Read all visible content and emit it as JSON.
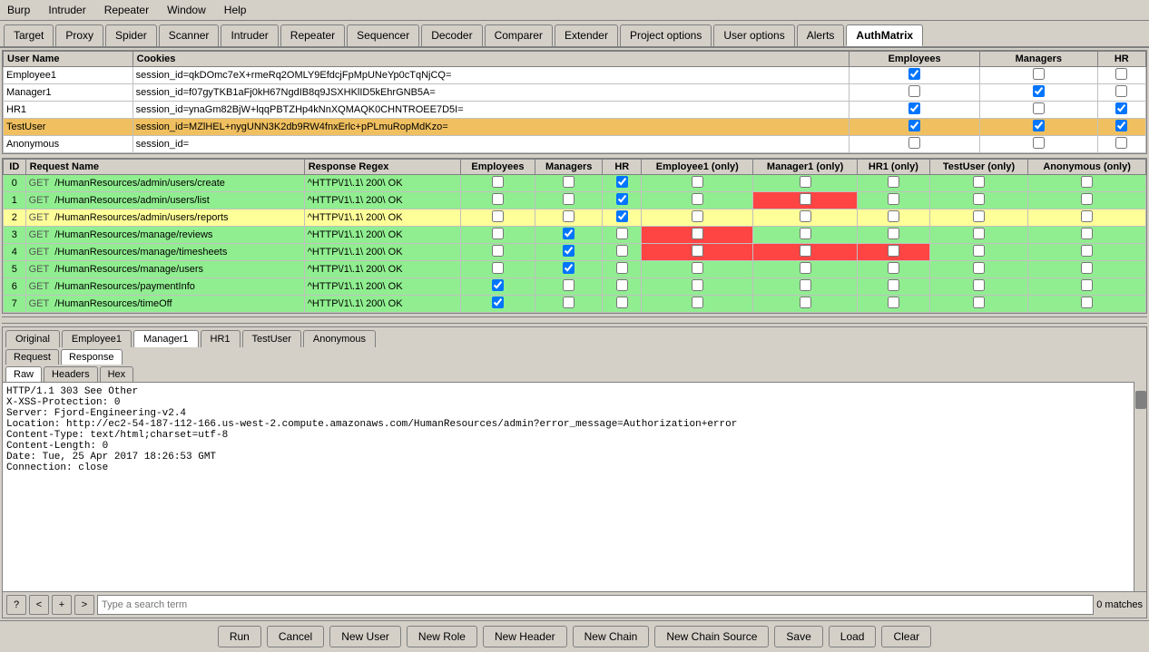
{
  "menu": {
    "items": [
      "Burp",
      "Intruder",
      "Repeater",
      "Window",
      "Help"
    ]
  },
  "tabs": {
    "items": [
      "Target",
      "Proxy",
      "Spider",
      "Scanner",
      "Intruder",
      "Repeater",
      "Sequencer",
      "Decoder",
      "Comparer",
      "Extender",
      "Project options",
      "User options",
      "Alerts",
      "AuthMatrix"
    ],
    "active": "AuthMatrix"
  },
  "user_table": {
    "headers": [
      "User Name",
      "Cookies",
      "Employees",
      "Managers",
      "HR"
    ],
    "rows": [
      {
        "name": "Employee1",
        "cookies": "session_id=qkDOmc7eX+rmeRq2OMLY9EfdcjFpMpUNeYp0cTqNjCQ=",
        "employees": true,
        "managers": false,
        "hr": false,
        "selected": false
      },
      {
        "name": "Manager1",
        "cookies": "session_id=f07gyTKB1aFj0kH67NgdIB8q9JSXHKlID5kEhrGNB5A=",
        "employees": false,
        "managers": true,
        "hr": false,
        "selected": false
      },
      {
        "name": "HR1",
        "cookies": "session_id=ynaGm82BjW+lqqPBTZHp4kNnXQMAQK0CHNTROEE7D5I=",
        "employees": true,
        "managers": false,
        "hr": true,
        "selected": false
      },
      {
        "name": "TestUser",
        "cookies": "session_id=MZlHEL+nygUNN3K2db9RW4fnxErlc+pPLmuRopMdKzo=",
        "employees": true,
        "managers": true,
        "hr": true,
        "selected": true
      },
      {
        "name": "Anonymous",
        "cookies": "session_id=",
        "employees": false,
        "managers": false,
        "hr": false,
        "selected": false
      }
    ]
  },
  "request_table": {
    "headers": [
      "ID",
      "Request Name",
      "Response Regex",
      "Employees",
      "Managers",
      "HR",
      "Employee1 (only)",
      "Manager1 (only)",
      "HR1 (only)",
      "TestUser (only)",
      "Anonymous (only)"
    ],
    "rows": [
      {
        "id": "0",
        "method": "GET",
        "path": "/HumanResources/admin/users/create",
        "regex": "^HTTP\\/1\\.1\\ 200\\ OK",
        "employees": false,
        "managers": false,
        "hr": true,
        "e1": false,
        "m1": false,
        "hr1": false,
        "tu": false,
        "anon": false,
        "color": "green"
      },
      {
        "id": "1",
        "method": "GET",
        "path": "/HumanResources/admin/users/list",
        "regex": "^HTTP\\/1\\.1\\ 200\\ OK",
        "employees": false,
        "managers": false,
        "hr": true,
        "e1": false,
        "m1": true,
        "hr1": false,
        "tu": false,
        "anon": false,
        "color": "green",
        "m1_red": true
      },
      {
        "id": "2",
        "method": "GET",
        "path": "/HumanResources/admin/users/reports",
        "regex": "^HTTP\\/1\\.1\\ 200\\ OK",
        "employees": false,
        "managers": false,
        "hr": true,
        "e1": false,
        "m1": false,
        "hr1": false,
        "tu": false,
        "anon": false,
        "color": "yellow",
        "selected": true
      },
      {
        "id": "3",
        "method": "GET",
        "path": "/HumanResources/manage/reviews",
        "regex": "^HTTP\\/1\\.1\\ 200\\ OK",
        "employees": false,
        "managers": true,
        "hr": false,
        "e1": false,
        "m1": false,
        "hr1": false,
        "tu": false,
        "anon": false,
        "color": "green",
        "e1_red": true
      },
      {
        "id": "4",
        "method": "GET",
        "path": "/HumanResources/manage/timesheets",
        "regex": "^HTTP\\/1\\.1\\ 200\\ OK",
        "employees": false,
        "managers": true,
        "hr": false,
        "e1": false,
        "m1": false,
        "hr1": false,
        "tu": false,
        "anon": false,
        "color": "green",
        "e1_red": true,
        "m1_red": true,
        "hr1_red": true
      },
      {
        "id": "5",
        "method": "GET",
        "path": "/HumanResources/manage/users",
        "regex": "^HTTP\\/1\\.1\\ 200\\ OK",
        "employees": false,
        "managers": true,
        "hr": false,
        "e1": false,
        "m1": false,
        "hr1": false,
        "tu": false,
        "anon": false,
        "color": "green"
      },
      {
        "id": "6",
        "method": "GET",
        "path": "/HumanResources/paymentInfo",
        "regex": "^HTTP\\/1\\.1\\ 200\\ OK",
        "employees": true,
        "managers": false,
        "hr": false,
        "e1": false,
        "m1": false,
        "hr1": false,
        "tu": false,
        "anon": false,
        "color": "green"
      },
      {
        "id": "7",
        "method": "GET",
        "path": "/HumanResources/timeOff",
        "regex": "^HTTP\\/1\\.1\\ 200\\ OK",
        "employees": true,
        "managers": false,
        "hr": false,
        "e1": false,
        "m1": false,
        "hr1": false,
        "tu": false,
        "anon": false,
        "color": "green"
      }
    ]
  },
  "viewer_tabs": {
    "items": [
      "Original",
      "Employee1",
      "Manager1",
      "HR1",
      "TestUser",
      "Anonymous"
    ],
    "active": "Manager1"
  },
  "req_resp_tabs": {
    "items": [
      "Request",
      "Response"
    ],
    "active": "Response"
  },
  "raw_hex_tabs": {
    "items": [
      "Raw",
      "Headers",
      "Hex"
    ],
    "active": "Raw"
  },
  "response_text": "HTTP/1.1 303 See Other\nX-XSS-Protection: 0\nServer: Fjord-Engineering-v2.4\nLocation: http://ec2-54-187-112-166.us-west-2.compute.amazonaws.com/HumanResources/admin?error_message=Authorization+error\nContent-Type: text/html;charset=utf-8\nContent-Length: 0\nDate: Tue, 25 Apr 2017 18:26:53 GMT\nConnection: close",
  "search": {
    "placeholder": "Type a search term",
    "match_count": "0 matches"
  },
  "buttons": {
    "run": "Run",
    "cancel": "Cancel",
    "new_user": "New User",
    "new_role": "New Role",
    "new_header": "New Header",
    "new_chain": "New Chain",
    "new_chain_source": "New Chain Source",
    "save": "Save",
    "load": "Load",
    "clear": "Clear"
  }
}
